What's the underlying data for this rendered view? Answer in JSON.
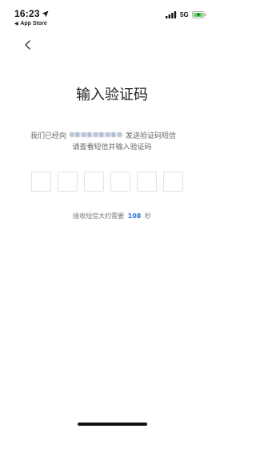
{
  "status_bar": {
    "time": "16:23",
    "back_to_app": "App Store",
    "network": "5G",
    "icons": [
      "location-arrow-icon",
      "signal-icon",
      "battery-charging-icon"
    ],
    "battery_color": "#5ed25e"
  },
  "nav": {
    "back_icon": "chevron-left-icon"
  },
  "page": {
    "title": "输入验证码",
    "sent_prefix": "我们已经向",
    "sent_suffix": "发送验证码短信",
    "check_text": "请查看短信并输入验证码",
    "code_box_count": 6,
    "countdown_prefix": "接收短信大约需要",
    "countdown_seconds": "108",
    "countdown_suffix": "秒"
  },
  "colors": {
    "accent": "#2b73d6",
    "text_secondary": "#666666"
  }
}
